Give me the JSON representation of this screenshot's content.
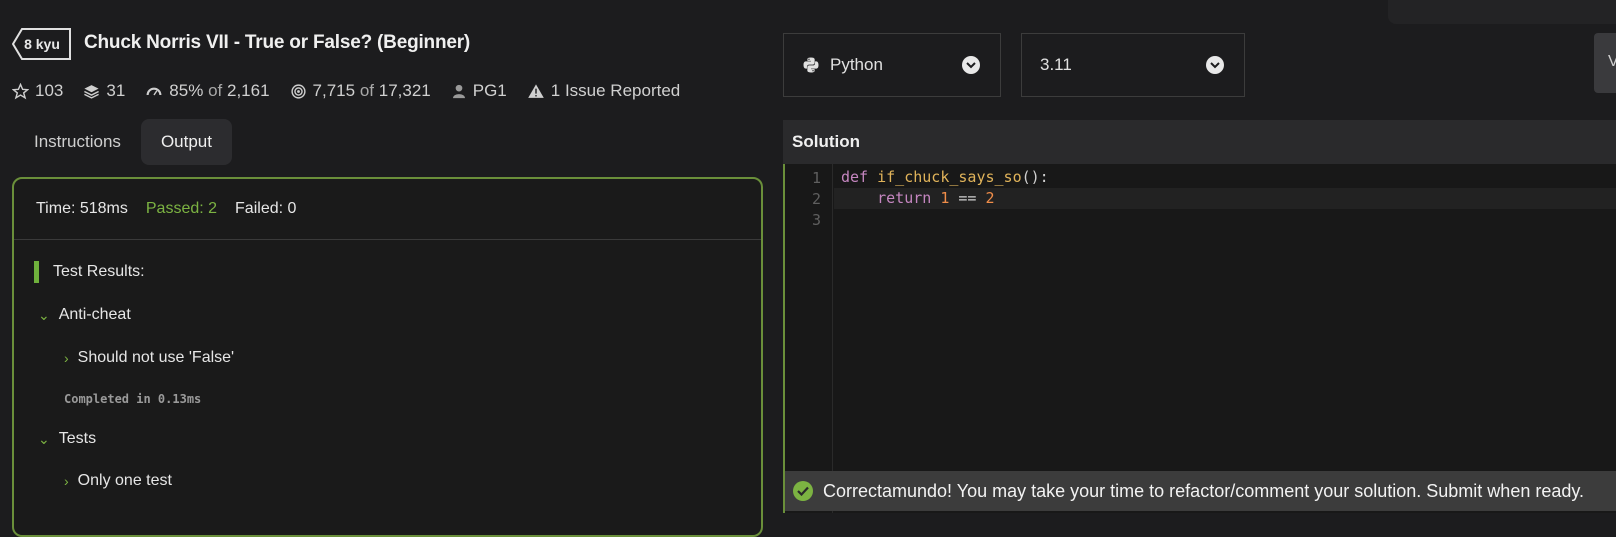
{
  "kata": {
    "rank": "8 kyu",
    "title": "Chuck Norris VII - True or False? (Beginner)"
  },
  "stats": {
    "stars": "103",
    "collections": "31",
    "satisfaction": "85%",
    "satisfaction_of": "of",
    "satisfaction_total": "2,161",
    "completed": "7,715",
    "completed_of": "of",
    "completed_total": "17,321",
    "author": "PG1",
    "issues": "1 Issue Reported"
  },
  "tabs": [
    {
      "label": "Instructions",
      "active": false
    },
    {
      "label": "Output",
      "active": true
    }
  ],
  "output": {
    "time": "Time: 518ms",
    "passed": "Passed: 2",
    "failed": "Failed: 0",
    "results_label": "Test Results:",
    "groups": [
      {
        "label": "Anti-cheat",
        "items": [
          {
            "label": "Should not use 'False'"
          }
        ],
        "completed": "Completed in 0.13ms"
      },
      {
        "label": "Tests",
        "items": [
          {
            "label": "Only one test"
          }
        ]
      }
    ]
  },
  "language_select": {
    "value": "Python",
    "icon": "python-icon"
  },
  "version_select": {
    "value": "3.11"
  },
  "side_button": {
    "label": "V"
  },
  "solution": {
    "header": "Solution",
    "line_numbers": [
      "1",
      "2",
      "3"
    ],
    "code": {
      "line1_kw": "def",
      "line1_fn": "if_chuck_says_so",
      "line1_rest": "():",
      "line2_kw": "return",
      "line2_a": "1",
      "line2_op": "==",
      "line2_b": "2"
    }
  },
  "toast": {
    "message": "Correctamundo! You may take your time to refactor/comment your solution. Submit when ready."
  },
  "colors": {
    "accent_green": "#7cb342",
    "border_green": "#6a8f3a",
    "background": "#1c1c1e"
  }
}
